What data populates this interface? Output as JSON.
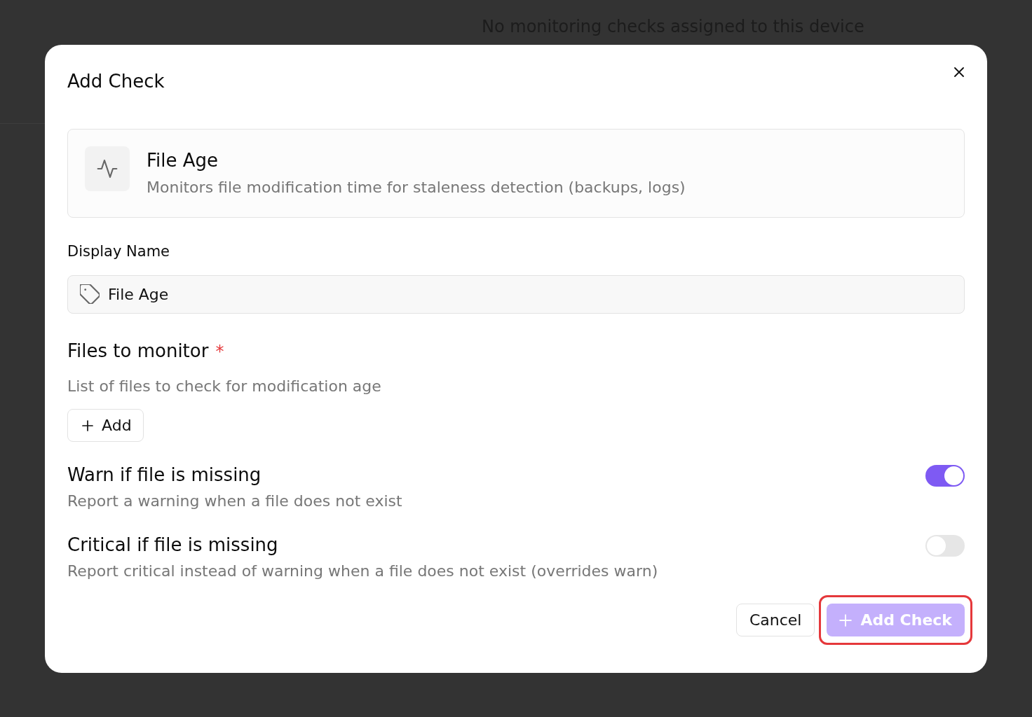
{
  "background": {
    "message": "No monitoring checks assigned to this device"
  },
  "dialog": {
    "title": "Add Check",
    "check_type": {
      "name": "File Age",
      "description": "Monitors file modification time for staleness detection (backups, logs)"
    },
    "display_name": {
      "label": "Display Name",
      "value": "File Age"
    },
    "files": {
      "label": "Files to monitor",
      "required_mark": "*",
      "description": "List of files to check for modification age",
      "add_button": "Add"
    },
    "toggles": [
      {
        "label": "Warn if file is missing",
        "description": "Report a warning when a file does not exist",
        "on": true
      },
      {
        "label": "Critical if file is missing",
        "description": "Report critical instead of warning when a file does not exist (overrides warn)",
        "on": false
      }
    ],
    "buttons": [
      {
        "label": "Cancel",
        "kind": "secondary",
        "disabled": false,
        "highlighted": false
      },
      {
        "label": "Add Check",
        "kind": "primary",
        "disabled": true,
        "highlighted": true
      }
    ]
  }
}
